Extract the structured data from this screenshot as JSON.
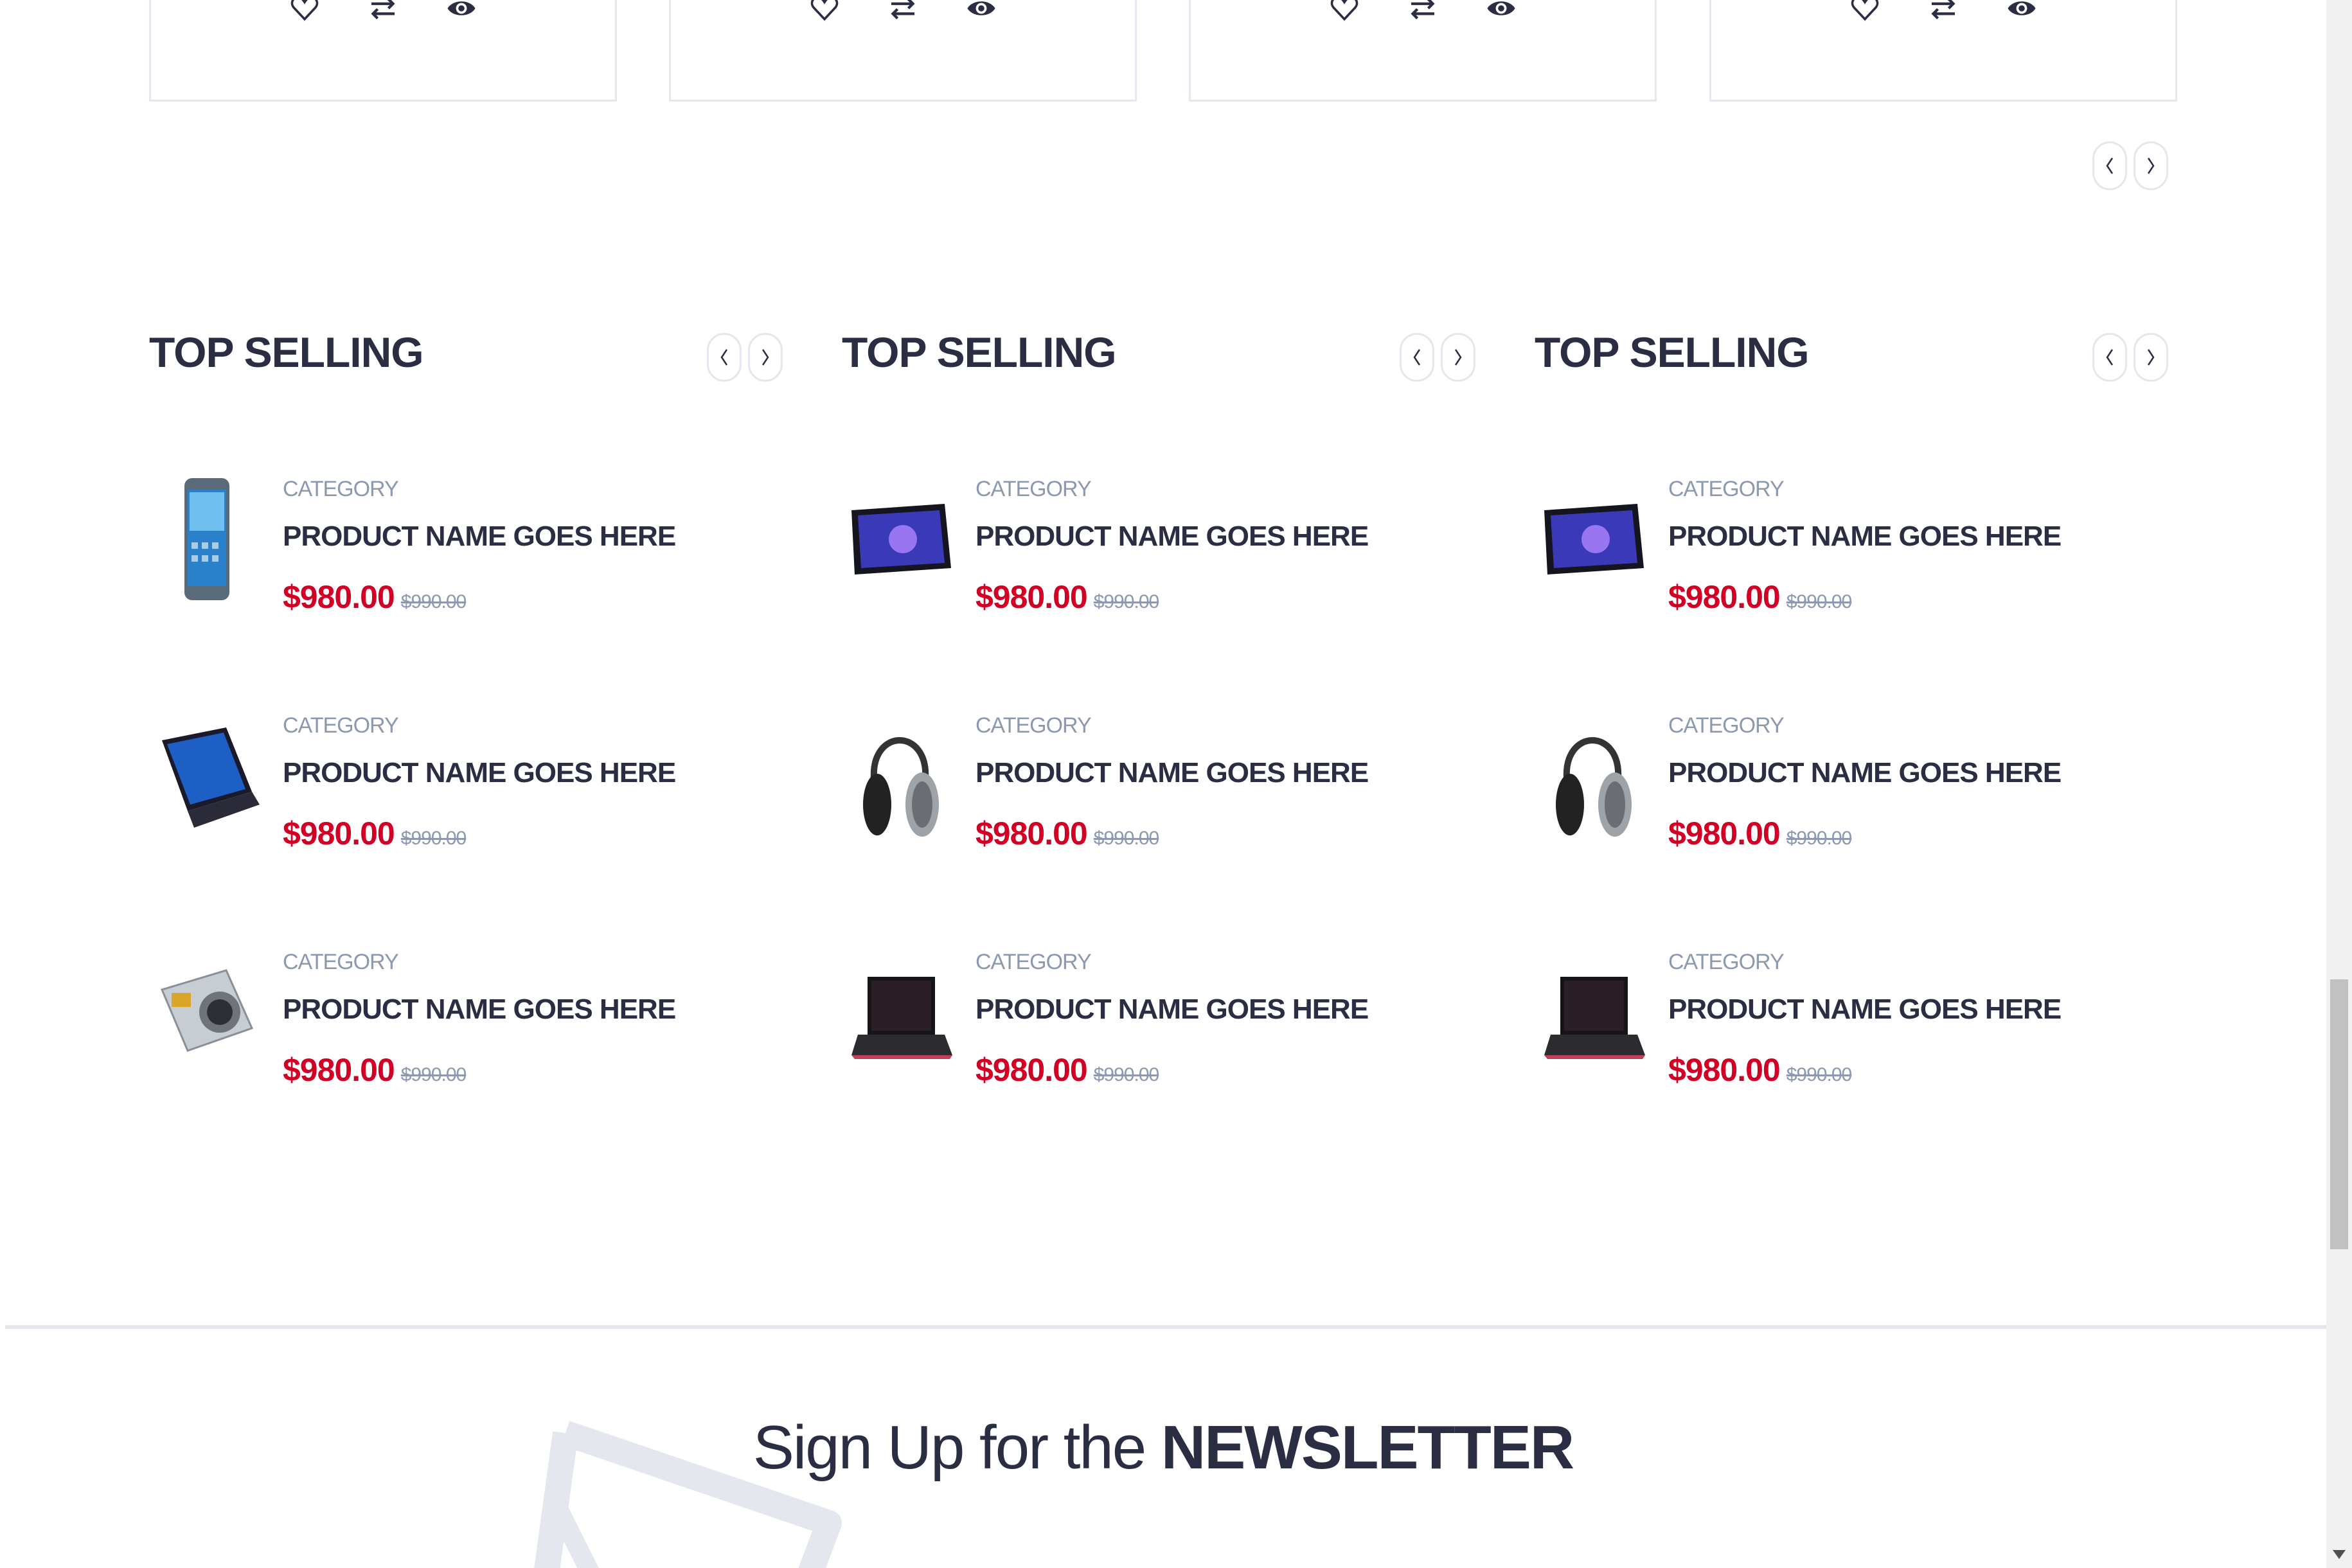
{
  "colors": {
    "accent": "#d10024",
    "dark": "#2b2d42",
    "muted": "#8d99ae",
    "border": "#e4e7ed"
  },
  "product_cards": [
    {
      "icons": [
        "heart-icon",
        "exchange-icon",
        "eye-icon"
      ]
    },
    {
      "icons": [
        "heart-icon",
        "exchange-icon",
        "eye-icon"
      ]
    },
    {
      "icons": [
        "heart-icon",
        "exchange-icon",
        "eye-icon"
      ]
    },
    {
      "icons": [
        "heart-icon",
        "exchange-icon",
        "eye-icon"
      ]
    }
  ],
  "columns": [
    {
      "title": "TOP SELLING",
      "products": [
        {
          "image": "phone",
          "category": "CATEGORY",
          "name": "PRODUCT NAME GOES HERE",
          "price": "$980.00",
          "old_price": "$990.00"
        },
        {
          "image": "laptop",
          "category": "CATEGORY",
          "name": "PRODUCT NAME GOES HERE",
          "price": "$980.00",
          "old_price": "$990.00"
        },
        {
          "image": "camera",
          "category": "CATEGORY",
          "name": "PRODUCT NAME GOES HERE",
          "price": "$980.00",
          "old_price": "$990.00"
        }
      ]
    },
    {
      "title": "TOP SELLING",
      "products": [
        {
          "image": "tablet",
          "category": "CATEGORY",
          "name": "PRODUCT NAME GOES HERE",
          "price": "$980.00",
          "old_price": "$990.00"
        },
        {
          "image": "headphones",
          "category": "CATEGORY",
          "name": "PRODUCT NAME GOES HERE",
          "price": "$980.00",
          "old_price": "$990.00"
        },
        {
          "image": "laptop-dark",
          "category": "CATEGORY",
          "name": "PRODUCT NAME GOES HERE",
          "price": "$980.00",
          "old_price": "$990.00"
        }
      ]
    },
    {
      "title": "TOP SELLING",
      "products": [
        {
          "image": "tablet",
          "category": "CATEGORY",
          "name": "PRODUCT NAME GOES HERE",
          "price": "$980.00",
          "old_price": "$990.00"
        },
        {
          "image": "headphones",
          "category": "CATEGORY",
          "name": "PRODUCT NAME GOES HERE",
          "price": "$980.00",
          "old_price": "$990.00"
        },
        {
          "image": "laptop-dark",
          "category": "CATEGORY",
          "name": "PRODUCT NAME GOES HERE",
          "price": "$980.00",
          "old_price": "$990.00"
        }
      ]
    }
  ],
  "newsletter": {
    "prefix": "Sign Up for the",
    "emphasis": "NEWSLETTER"
  }
}
